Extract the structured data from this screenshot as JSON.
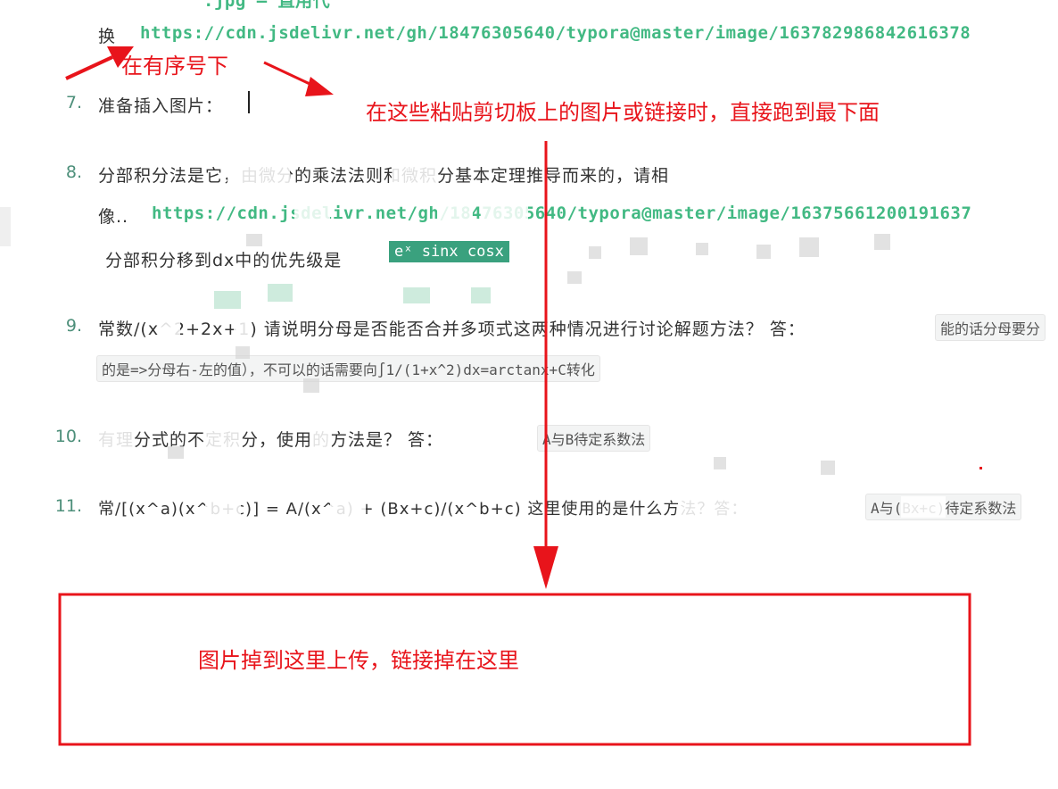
{
  "doc": {
    "line_top_partial": ".jpg — 直用代",
    "line_huan_prefix": "换",
    "line_huan_link": "https://cdn.jsdelivr.net/gh/18476305640/typora@master/image/163782986842616378",
    "items": [
      {
        "num": "7.",
        "text": "准备插入图片："
      },
      {
        "num": "8.",
        "text": "分部积分法是它，由微分的乘法法则和微积分基本定理推导而来的，请相",
        "text2_prefix": "像..",
        "link": "https://cdn.jsdelivr.net/gh/18476305640/typora@master/image/16375661200191637",
        "text3": "分部积分移到dx中的优先级是",
        "highlight": "eˣ sinx cosx"
      },
      {
        "num": "9.",
        "text": "常数/(x^2+2x+1) 请说明分母是否能否合并多项式这两种情况进行讨论解题方法？ 答：",
        "code1": "能的话分母要分",
        "code2": "的是=>分母右-左的值），不可以的话需要向∫1/(1+x^2)dx=arctanx+C转化"
      },
      {
        "num": "10.",
        "text": "有理分式的不定积分，使用的方法是？ 答：",
        "code": "A与B待定系数法"
      },
      {
        "num": "11.",
        "text": "常/[(x^a)(x^b+c)] = A/(x^a) + (Bx+c)/(x^b+c)  这里使用的是什么方法？答：",
        "code": "A与(Bx+c)待定系数法"
      }
    ]
  },
  "annotations": {
    "arrow_label_left": "在有序号下",
    "arrow_label_right": "在这些粘贴剪切板上的图片或链接时，直接跑到最下面",
    "box_label": "图片掉到这里上传，链接掉在这里",
    "color": "#e8141b"
  }
}
